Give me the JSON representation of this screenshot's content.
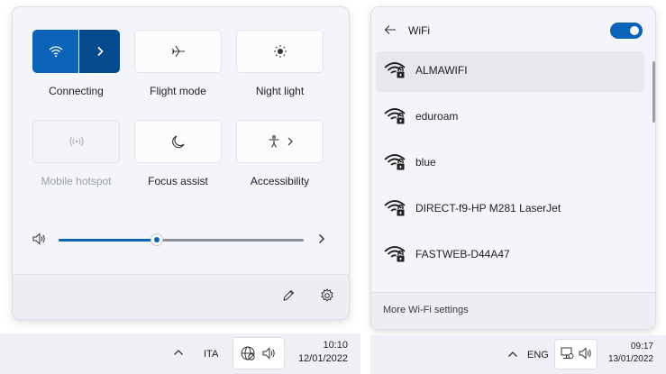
{
  "quick_settings": {
    "tiles": [
      {
        "label": "Connecting",
        "icon": "wifi-icon",
        "state": "active"
      },
      {
        "label": "Flight mode",
        "icon": "airplane-icon",
        "state": "off"
      },
      {
        "label": "Night light",
        "icon": "brightness-icon",
        "state": "off"
      },
      {
        "label": "Mobile hotspot",
        "icon": "hotspot-icon",
        "state": "disabled"
      },
      {
        "label": "Focus assist",
        "icon": "moon-icon",
        "state": "off"
      },
      {
        "label": "Accessibility",
        "icon": "accessibility-icon",
        "state": "off"
      }
    ],
    "volume": {
      "level": 0.4,
      "icon": "speaker-icon"
    },
    "bottom_icons": [
      "pencil-icon",
      "gear-icon"
    ]
  },
  "left_taskbar": {
    "language": "ITA",
    "time": "10:10",
    "date": "12/01/2022",
    "icons": [
      "chevron-up-icon",
      "globe-icon",
      "speaker-icon"
    ]
  },
  "wifi_panel": {
    "title": "WiFi",
    "enabled": true,
    "networks": [
      {
        "name": "ALMAWIFI",
        "secured": true,
        "selected": true
      },
      {
        "name": "eduroam",
        "secured": true
      },
      {
        "name": "blue",
        "secured": true
      },
      {
        "name": "DIRECT-f9-HP M281 LaserJet",
        "secured": true
      },
      {
        "name": "FASTWEB-D44A47",
        "secured": true
      }
    ],
    "footer_link": "More Wi-Fi settings"
  },
  "right_taskbar": {
    "language": "ENG",
    "time": "09:17",
    "date": "13/01/2022",
    "icons": [
      "chevron-up-icon",
      "network-icon",
      "speaker-icon"
    ]
  },
  "colors": {
    "accent": "#0a63b7",
    "accent_dark": "#054a8c",
    "panel_bg": "#f4f5fa",
    "footer_bg": "#eceef4",
    "taskbar_bg": "#eef0f6"
  }
}
